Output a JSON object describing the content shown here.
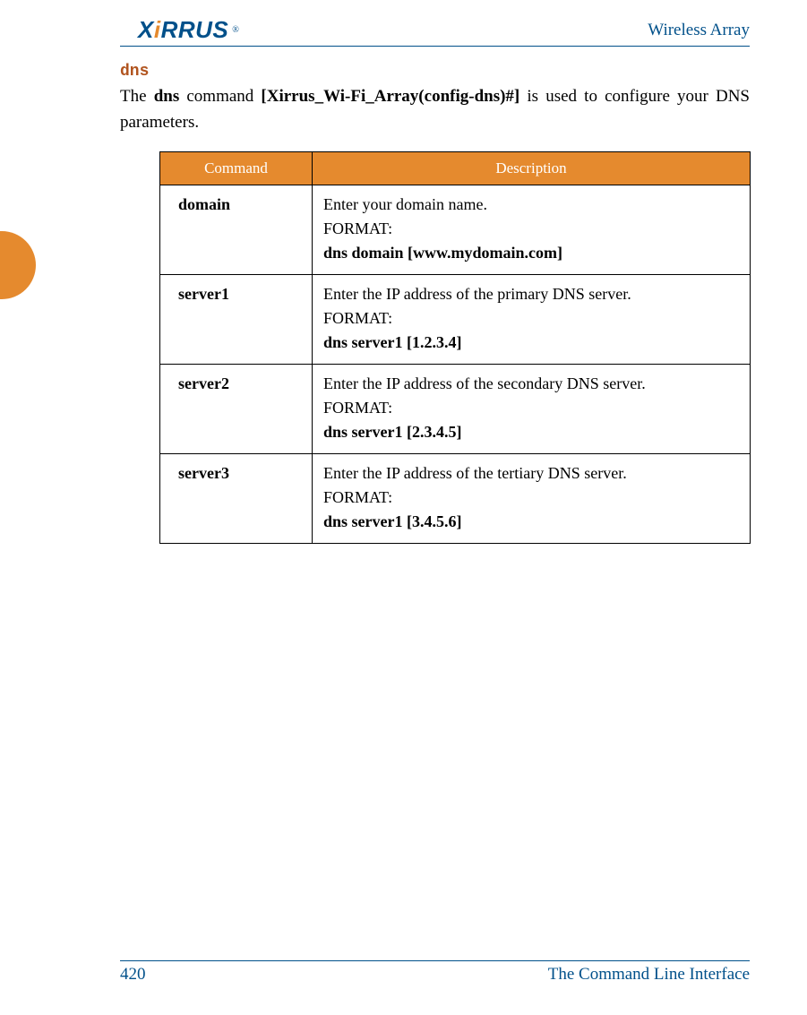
{
  "header": {
    "logo_text_html": "X<span class=\"i-dot\">i</span>RRUS",
    "logo_sup": "®",
    "subtitle": "Wireless Array"
  },
  "section": {
    "title": "dns",
    "body_html": "The <span class=\"bold\">dns</span> command <span class=\"bold\">[Xirrus_Wi-Fi_Array(config-dns)#]</span> is used to configure your DNS parameters."
  },
  "table": {
    "headers": [
      "Command",
      "Description"
    ],
    "rows": [
      {
        "command": "domain",
        "desc_lead": "Enter your domain name.",
        "desc_format_label": "FORMAT:",
        "desc_example": "dns domain [www.mydomain.com]"
      },
      {
        "command": "server1",
        "desc_lead": "Enter the IP address of the primary DNS server.",
        "desc_format_label": "FORMAT:",
        "desc_example": "dns server1 [1.2.3.4]"
      },
      {
        "command": "server2",
        "desc_lead": "Enter the IP address of the secondary DNS server.",
        "desc_format_label": "FORMAT:",
        "desc_example": "dns server1 [2.3.4.5]"
      },
      {
        "command": "server3",
        "desc_lead": "Enter the IP address of the tertiary DNS server.",
        "desc_format_label": "FORMAT:",
        "desc_example": "dns server1 [3.4.5.6]"
      }
    ]
  },
  "footer": {
    "page_number": "420",
    "chapter": "The Command Line Interface"
  }
}
